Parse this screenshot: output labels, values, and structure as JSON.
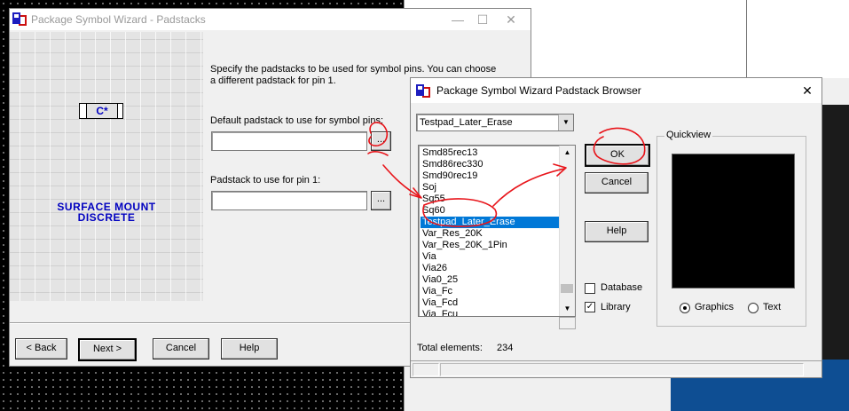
{
  "wizard": {
    "title": "Package Symbol Wizard - Padstacks",
    "instructions_line1": "Specify the padstacks to be used for symbol pins. You can choose",
    "instructions_line2": "a different padstack for pin 1.",
    "default_label": "Default padstack to use for symbol pins:",
    "default_value": "",
    "pin1_label": "Padstack to use for pin 1:",
    "pin1_value": "",
    "browse_label": "...",
    "chip_label": "C*",
    "type_line1": "SURFACE MOUNT",
    "type_line2": "DISCRETE",
    "buttons": {
      "back": "< Back",
      "next": "Next >",
      "cancel": "Cancel",
      "help": "Help"
    }
  },
  "browser": {
    "title": "Package Symbol Wizard Padstack Browser",
    "filter_value": "Testpad_Later_Erase",
    "list_items": [
      "Smd85rec13",
      "Smd86rec330",
      "Smd90rec19",
      "Soj",
      "Sq55",
      "Sq60",
      "Testpad_Later_Erase",
      "Var_Res_20K",
      "Var_Res_20K_1Pin",
      "Via",
      "Via26",
      "Via0_25",
      "Via_Fc",
      "Via_Fcd",
      "Via_Fcu"
    ],
    "selected_item": "Testpad_Later_Erase",
    "buttons": {
      "ok": "OK",
      "cancel": "Cancel",
      "help": "Help"
    },
    "quickview_label": "Quickview",
    "checkbox_database": {
      "label": "Database",
      "checked": false
    },
    "checkbox_library": {
      "label": "Library",
      "checked": true
    },
    "radio_graphics": {
      "label": "Graphics",
      "selected": true
    },
    "radio_text": {
      "label": "Text",
      "selected": false
    },
    "total_label": "Total elements:",
    "total_value": "234"
  },
  "colors": {
    "selection": "#0078d7",
    "annotation": "#e8141a",
    "wizard_type_text": "#0000c0"
  }
}
